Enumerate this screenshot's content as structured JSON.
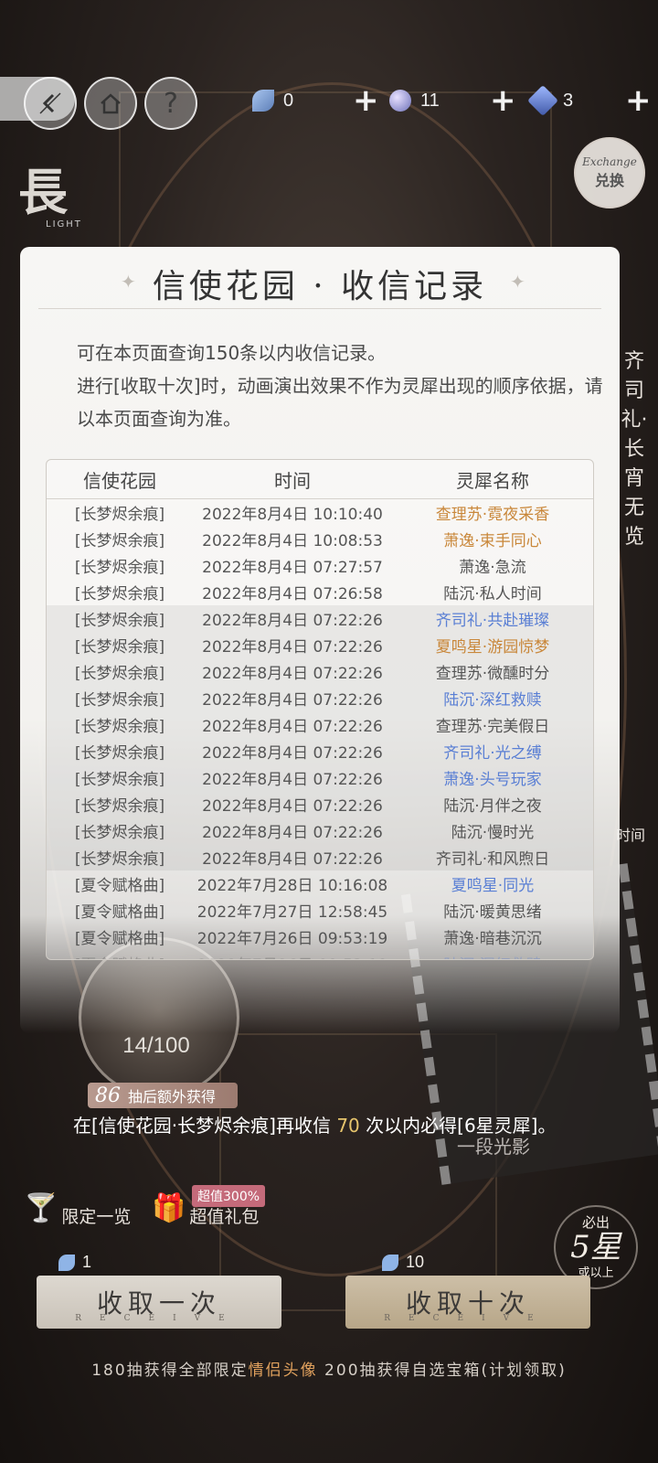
{
  "topbar": {
    "resources": [
      {
        "icon": "feather-icon",
        "value": "0"
      },
      {
        "icon": "orb-icon",
        "value": "11"
      },
      {
        "icon": "crystal-icon",
        "value": "3"
      }
    ],
    "help_label": "?",
    "exchange": {
      "script_label": "Exchange",
      "label": "兑换"
    }
  },
  "banner": {
    "side_title": "長",
    "light_label": "LIGHT",
    "right_vertical": "齐司礼·长宵无览",
    "right_time": "时间"
  },
  "modal": {
    "title": "信使花园 · 收信记录",
    "desc_line1": "可在本页面查询150条以内收信记录。",
    "desc_line2": "进行[收取十次]时，动画演出效果不作为灵犀出现的顺序依据，请以本页面查询为准。",
    "headers": [
      "信使花园",
      "时间",
      "灵犀名称"
    ],
    "rows": [
      {
        "pool": "[长梦烬余痕]",
        "time": "2022年8月4日 10:10:40",
        "name": "查理苏·霓夜采香",
        "color": "orange",
        "group": "a"
      },
      {
        "pool": "[长梦烬余痕]",
        "time": "2022年8月4日 10:08:53",
        "name": "萧逸·束手同心",
        "color": "orange",
        "group": "a"
      },
      {
        "pool": "[长梦烬余痕]",
        "time": "2022年8月4日 07:27:57",
        "name": "萧逸·急流",
        "color": "normal",
        "group": "a"
      },
      {
        "pool": "[长梦烬余痕]",
        "time": "2022年8月4日 07:26:58",
        "name": "陆沉·私人时间",
        "color": "normal",
        "group": "a"
      },
      {
        "pool": "[长梦烬余痕]",
        "time": "2022年8月4日 07:22:26",
        "name": "齐司礼·共赴璀璨",
        "color": "blue",
        "group": "b"
      },
      {
        "pool": "[长梦烬余痕]",
        "time": "2022年8月4日 07:22:26",
        "name": "夏鸣星·游园惊梦",
        "color": "orange",
        "group": "b"
      },
      {
        "pool": "[长梦烬余痕]",
        "time": "2022年8月4日 07:22:26",
        "name": "查理苏·微醺时分",
        "color": "normal",
        "group": "b"
      },
      {
        "pool": "[长梦烬余痕]",
        "time": "2022年8月4日 07:22:26",
        "name": "陆沉·深红救赎",
        "color": "blue",
        "group": "b"
      },
      {
        "pool": "[长梦烬余痕]",
        "time": "2022年8月4日 07:22:26",
        "name": "查理苏·完美假日",
        "color": "normal",
        "group": "b"
      },
      {
        "pool": "[长梦烬余痕]",
        "time": "2022年8月4日 07:22:26",
        "name": "齐司礼·光之缚",
        "color": "blue",
        "group": "b"
      },
      {
        "pool": "[长梦烬余痕]",
        "time": "2022年8月4日 07:22:26",
        "name": "萧逸·头号玩家",
        "color": "blue",
        "group": "b"
      },
      {
        "pool": "[长梦烬余痕]",
        "time": "2022年8月4日 07:22:26",
        "name": "陆沉·月伴之夜",
        "color": "normal",
        "group": "b"
      },
      {
        "pool": "[长梦烬余痕]",
        "time": "2022年8月4日 07:22:26",
        "name": "陆沉·慢时光",
        "color": "normal",
        "group": "b"
      },
      {
        "pool": "[长梦烬余痕]",
        "time": "2022年8月4日 07:22:26",
        "name": "齐司礼·和风煦日",
        "color": "normal",
        "group": "b"
      },
      {
        "pool": "[夏令赋格曲]",
        "time": "2022年7月28日 10:16:08",
        "name": "夏鸣星·同光",
        "color": "blue",
        "group": "a"
      },
      {
        "pool": "[夏令赋格曲]",
        "time": "2022年7月27日 12:58:45",
        "name": "陆沉·暖黄思绪",
        "color": "normal",
        "group": "a"
      },
      {
        "pool": "[夏令赋格曲]",
        "time": "2022年7月26日 09:53:19",
        "name": "萧逸·暗巷沉沉",
        "color": "normal",
        "group": "a"
      },
      {
        "pool": "[夏令赋格曲]",
        "time": "2022年7月26日 09:53:19",
        "name": "陆沉·深红救赎",
        "color": "blue",
        "group": "fade"
      }
    ]
  },
  "pity": {
    "count": "14/100",
    "extra_num": "86",
    "extra_text": "抽后额外获得",
    "guarantee_pre": "在[信使花园·长梦烬余痕]再收信",
    "guarantee_num": "70",
    "guarantee_post": "次以内必得[6星灵犀]。"
  },
  "film_label": "一段光影",
  "shortcuts": {
    "limited": "限定一览",
    "gift": "超值礼包",
    "gift_badge": "超值300%"
  },
  "five_star": {
    "top": "必出",
    "main": "5星",
    "bottom": "或以上"
  },
  "draw": {
    "one_cost": "1",
    "ten_cost": "10",
    "one_label": "收取一次",
    "ten_label": "收取十次",
    "sub_label": "RECEIVE"
  },
  "footer": {
    "pre": "180抽获得全部限定",
    "highlight": "情侣头像",
    "post": " 200抽获得自选宝箱(计划领取)"
  }
}
